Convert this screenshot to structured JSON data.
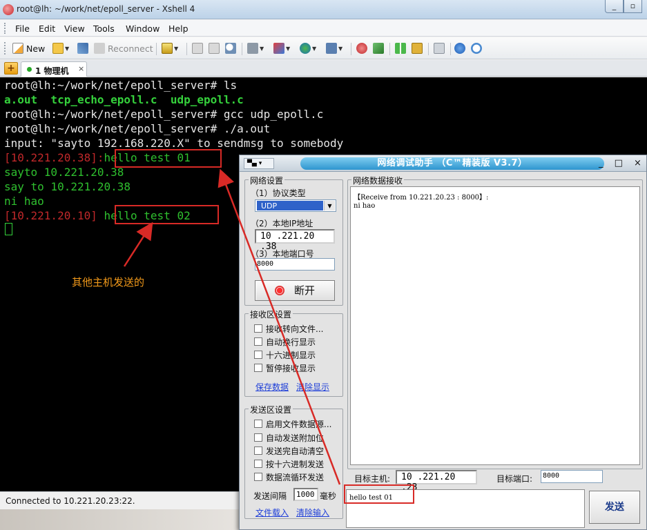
{
  "xshell": {
    "title": "root@lh: ~/work/net/epoll_server - Xshell 4",
    "window_buttons": {
      "minimize": "_",
      "maximize": "▫"
    },
    "menu": [
      "File",
      "Edit",
      "View",
      "Tools",
      "Window",
      "Help"
    ],
    "toolbar": {
      "new_label": "New",
      "reconnect_label": "Reconnect"
    },
    "tab": {
      "add_label": "+",
      "label": "1 物理机",
      "close": "×"
    },
    "terminal": [
      {
        "segments": [
          {
            "text": "root@lh:~/work/net/epoll_server# ls",
            "color": "white"
          }
        ]
      },
      {
        "segments": [
          {
            "text": "a.out  tcp_echo_epoll.c  udp_epoll.c",
            "color": "green"
          }
        ]
      },
      {
        "segments": [
          {
            "text": "root@lh:~/work/net/epoll_server# gcc udp_epoll.c",
            "color": "white"
          }
        ]
      },
      {
        "segments": [
          {
            "text": "root@lh:~/work/net/epoll_server# ./a.out",
            "color": "white"
          }
        ]
      },
      {
        "segments": [
          {
            "text": "input: \"sayto 192.168.220.X\" to sendmsg to somebody",
            "color": "white"
          }
        ]
      },
      {
        "segments": [
          {
            "text": "[10.221.20.38]:",
            "color": "red"
          },
          {
            "text": "hello test 01",
            "color": "lgreen"
          }
        ]
      },
      {
        "segments": [
          {
            "text": "sayto 10.221.20.38",
            "color": "lgreen"
          }
        ]
      },
      {
        "segments": [
          {
            "text": "say to 10.221.20.38",
            "color": "lgreen"
          }
        ]
      },
      {
        "segments": [
          {
            "text": "ni hao",
            "color": "lgreen"
          }
        ]
      },
      {
        "segments": [
          {
            "text": "[10.221.20.10]",
            "color": "red"
          },
          {
            "text": " hello test 02",
            "color": "lgreen"
          }
        ]
      }
    ],
    "status": "Connected to 10.221.20.23:22.",
    "annotation": "其他主机发送的",
    "colors": {
      "white": "#e6e6e6",
      "green": "#35d13c",
      "lgreen": "#2fc02f",
      "red": "#c0282a",
      "annotation_red": "#d82a26"
    }
  },
  "netassist": {
    "sysmenu": "▾",
    "title": "网络调试助手 （C™精装版 V3.7）",
    "title_buttons": "_ □ ×",
    "net_settings": {
      "title": "网络设置",
      "protocol_label": "（1）协议类型",
      "protocol_value": "UDP",
      "ip_label": "（2）本地IP地址",
      "ip_value": "10 .221.20 .38",
      "port_label": "（3）本地端口号",
      "port_value": "8000",
      "disconnect_button": "断开"
    },
    "recv_settings": {
      "title": "接收区设置",
      "options": [
        "接收转向文件...",
        "自动换行显示",
        "十六进制显示",
        "暂停接收显示"
      ],
      "save_link": "保存数据",
      "clear_link": "清除显示"
    },
    "send_settings": {
      "title": "发送区设置",
      "options": [
        "启用文件数据源...",
        "自动发送附加位",
        "发送完自动清空",
        "按十六进制发送",
        "数据流循环发送"
      ],
      "interval_label": "发送间隔",
      "interval_value": "1000",
      "interval_unit": "毫秒",
      "load_link": "文件载入",
      "clear_link": "清除输入"
    },
    "recv_area": {
      "title": "网络数据接收",
      "lines": [
        "【Receive from 10.221.20.23 : 8000】:",
        "ni hao"
      ]
    },
    "target": {
      "host_label": "目标主机:",
      "host_value": "10 .221.20 .23",
      "port_label": "目标端口:",
      "port_value": "8000"
    },
    "send_text": "hello test 01",
    "send_button": "发送"
  }
}
